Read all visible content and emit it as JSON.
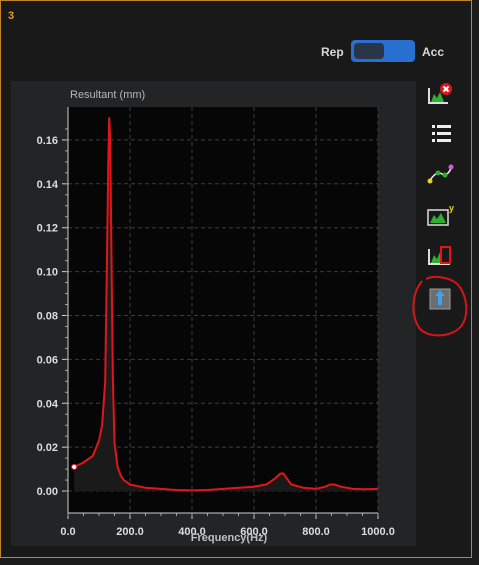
{
  "panel": {
    "number": "3"
  },
  "toggle": {
    "left_label": "Rep",
    "right_label": "Acc",
    "selected": "Rep"
  },
  "chart_data": {
    "type": "line",
    "title": "Resultant (mm)",
    "xlabel": "Frequency(Hz)",
    "ylabel": "",
    "xlim": [
      0,
      1000
    ],
    "ylim": [
      -0.01,
      0.175
    ],
    "xticks": [
      "0.0",
      "200.0",
      "400.0",
      "600.0",
      "800.0",
      "1000.0"
    ],
    "yticks": [
      "0.00",
      "0.02",
      "0.04",
      "0.06",
      "0.08",
      "0.10",
      "0.12",
      "0.14",
      "0.16"
    ],
    "grid": true,
    "series": [
      {
        "color": "#e0161b",
        "x": [
          20,
          50,
          80,
          100,
          110,
          120,
          125,
          130,
          133,
          136,
          140,
          145,
          150,
          160,
          170,
          180,
          200,
          250,
          300,
          350,
          400,
          450,
          500,
          550,
          600,
          640,
          670,
          685,
          695,
          705,
          720,
          760,
          800,
          830,
          845,
          860,
          880,
          920,
          960,
          1000
        ],
        "y": [
          0.011,
          0.013,
          0.016,
          0.023,
          0.03,
          0.05,
          0.1,
          0.15,
          0.17,
          0.16,
          0.11,
          0.05,
          0.022,
          0.011,
          0.007,
          0.005,
          0.003,
          0.0015,
          0.001,
          0.0005,
          0.0003,
          0.0005,
          0.001,
          0.0015,
          0.002,
          0.003,
          0.006,
          0.008,
          0.008,
          0.006,
          0.003,
          0.0015,
          0.001,
          0.002,
          0.003,
          0.003,
          0.002,
          0.001,
          0.0008,
          0.001
        ]
      }
    ],
    "marker": {
      "x": 20,
      "y": 0.011
    }
  },
  "toolbar": {
    "items": [
      {
        "name": "clear-plot-icon"
      },
      {
        "name": "list-icon"
      },
      {
        "name": "curve-fit-icon"
      },
      {
        "name": "y-axis-scale-icon"
      },
      {
        "name": "select-region-icon"
      },
      {
        "name": "export-upload-icon"
      }
    ]
  },
  "colors": {
    "accent_border": "#c0852a",
    "toggle_bg": "#2770d0",
    "trace": "#e0161b",
    "annotation": "#d4161b"
  }
}
